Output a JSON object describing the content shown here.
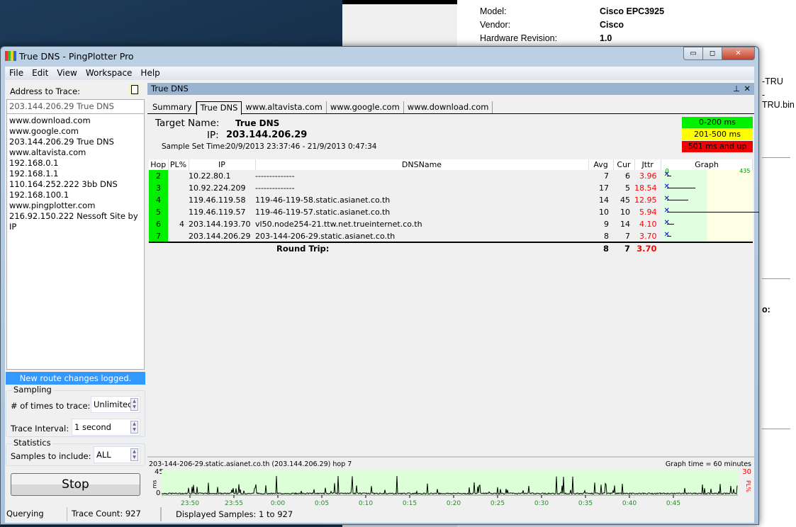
{
  "background": {
    "fields": [
      {
        "label": "Model:",
        "value": "Cisco EPC3925"
      },
      {
        "label": "Vendor:",
        "value": "Cisco"
      },
      {
        "label": "Hardware Revision:",
        "value": "1.0"
      }
    ],
    "frag1": "-TRU",
    "frag2": "-TRU.bin",
    "frag3": "o:"
  },
  "window": {
    "title": "True DNS - PingPlotter Pro",
    "minimize": "▭",
    "maximize": "◻",
    "close": "✕"
  },
  "menu": [
    "File",
    "Edit",
    "View",
    "Workspace",
    "Help"
  ],
  "left": {
    "address_label": "Address to Trace:",
    "address_value": "203.144.206.29 True DNS",
    "history": [
      "www.download.com",
      "www.google.com",
      "203.144.206.29 True DNS",
      "www.altavista.com",
      "192.168.0.1",
      "192.168.1.1",
      "110.164.252.222 3bb DNS",
      "192.168.100.1",
      "www.pingplotter.com",
      "216.92.150.222 Nessoft Site by IP"
    ],
    "banner": "New route changes logged.",
    "sampling": {
      "title": "Sampling",
      "times_label": "# of times to trace:",
      "times_value": "Unlimited",
      "interval_label": "Trace Interval:",
      "interval_value": "1 second"
    },
    "statistics": {
      "title": "Statistics",
      "samples_label": "Samples to include:",
      "samples_value": "ALL"
    },
    "stop": "Stop",
    "status": "Querying",
    "trace_count": "Trace Count: 927"
  },
  "panel": {
    "title": "True DNS",
    "pin": "⊥",
    "close": "✕",
    "tabs": [
      "Summary",
      "True DNS",
      "www.altavista.com",
      "www.google.com",
      "www.download.com"
    ],
    "target_label": "Target Name:",
    "target_value": "True DNS",
    "ip_label": "IP:",
    "ip_value": "203.144.206.29",
    "sst_label": "Sample Set Time:",
    "sst_value": "20/9/2013 23:37:46 - 21/9/2013 0:47:34",
    "legend": [
      {
        "label": "0-200 ms",
        "color": "#00f000"
      },
      {
        "label": "201-500 ms",
        "color": "#ffff00"
      },
      {
        "label": "501 ms and up",
        "color": "#f00000"
      }
    ],
    "columns": [
      "Hop",
      "PL%",
      "IP",
      "DNSName",
      "Avg",
      "Cur",
      "Jttr",
      "Graph"
    ],
    "graph_scale": {
      "min": "0",
      "max": "435"
    },
    "rows": [
      {
        "hop": "2",
        "pl": "",
        "ip": "10.22.80.1",
        "dns": "--------------",
        "avg": "7",
        "cur": "6",
        "jttr": "3.96"
      },
      {
        "hop": "3",
        "pl": "",
        "ip": "10.92.224.209",
        "dns": "--------------",
        "avg": "17",
        "cur": "5",
        "jttr": "18.54"
      },
      {
        "hop": "4",
        "pl": "",
        "ip": "119.46.119.58",
        "dns": "119-46-119-58.static.asianet.co.th",
        "avg": "14",
        "cur": "45",
        "jttr": "12.95"
      },
      {
        "hop": "5",
        "pl": "",
        "ip": "119.46.119.57",
        "dns": "119-46-119-57.static.asianet.co.th",
        "avg": "10",
        "cur": "10",
        "jttr": "5.94"
      },
      {
        "hop": "6",
        "pl": "4",
        "ip": "203.144.193.70",
        "dns": "vl50.node254-21.ttw.net.trueinternet.co.th",
        "avg": "9",
        "cur": "14",
        "jttr": "4.10"
      },
      {
        "hop": "7",
        "pl": "",
        "ip": "203.144.206.29",
        "dns": "203-144-206-29.static.asianet.co.th",
        "avg": "8",
        "cur": "7",
        "jttr": "3.70"
      }
    ],
    "round_trip": {
      "label": "Round Trip:",
      "avg": "8",
      "cur": "7",
      "jttr": "3.70"
    },
    "timeline": {
      "title": "203-144-206-29.static.asianet.co.th (203.144.206.29) hop 7",
      "graph_time": "Graph time = 60 minutes",
      "y_max": "45",
      "y_min": "0",
      "y_unit": "ms",
      "pl_max": "30",
      "pl_unit": "PL%",
      "ticks": [
        "23:50",
        "23:55",
        "0:00",
        "0:05",
        "0:10",
        "0:15",
        "0:20",
        "0:25",
        "0:30",
        "0:35",
        "0:40",
        "0:45"
      ]
    },
    "displayed": "Displayed Samples: 1 to 927"
  }
}
